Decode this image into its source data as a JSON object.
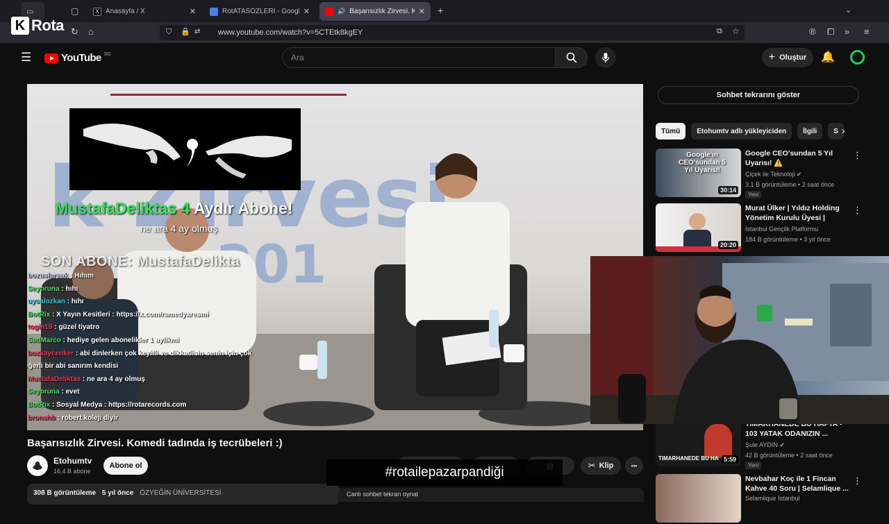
{
  "browser": {
    "tabs": [
      {
        "label": "Anasayfa / X",
        "active": false
      },
      {
        "label": "RotATASÖZLERİ - Google Dokü",
        "active": false
      },
      {
        "label": "Başarısızlık Zirvesi. Komedi",
        "active": true
      }
    ],
    "url": "www.youtube.com/watch?v=5CTEtk8kgEY",
    "new_tab": "+"
  },
  "overlay_logo": {
    "k": "K",
    "text": "Rota"
  },
  "youtube": {
    "logo": "YouTube",
    "region": "SG",
    "search_placeholder": "Ara",
    "create_label": "Oluştur"
  },
  "stream_overlay": {
    "sub_name": "MustafaDeliktas",
    "sub_months": "4",
    "sub_suffix": "Aydır Abone!",
    "sub_message": "ne ara 4 ay olmuş",
    "last_sub": "SON ABONE: MustafaDelikta",
    "banner_text": "k Zirvesi",
    "banner_year": "l 201",
    "hashtag": "#rotailepazarpandiği",
    "chat": [
      {
        "user": "bozuslarsuk",
        "msg": ": Hıhım",
        "color": "#b6b9e8"
      },
      {
        "user": "Seyoruna",
        "msg": ": hıhı",
        "color": "#3be05d"
      },
      {
        "user": "uysalozkan",
        "msg": ": hıhı",
        "color": "#35c8d8"
      },
      {
        "user": "BotRix",
        "msg": ": X Yayın Kesitleri : https://x.com/ramedyaresmi",
        "color": "#3be05d"
      },
      {
        "user": "togin19",
        "msg": ": güzel tiyatro",
        "color": "#e8355a"
      },
      {
        "user": "SadMarco",
        "msg": ": hediye gelen abonelikler 1 aylikmi",
        "color": "#3be05d"
      },
      {
        "user": "bozkaycenker",
        "msg": ": abi dinlerken çok keyifli ve dikkatlisin senin için çok",
        "color": "#e8355a"
      },
      {
        "user": "",
        "msg": "değerli bir abi sanırım kendisi",
        "color": "#ffffff"
      },
      {
        "user": "MustafaDeliktas",
        "msg": ": ne ara 4 ay olmuş",
        "color": "#e8355a"
      },
      {
        "user": "Seyoruna",
        "msg": ": evet",
        "color": "#3be05d"
      },
      {
        "user": "BotRix",
        "msg": ": Sosyal Medya : https://rotarecords.com",
        "color": "#3be05d"
      },
      {
        "user": "bronshb",
        "msg": ": robert koleji diyir",
        "color": "#e8355a"
      }
    ]
  },
  "video": {
    "title": "Başarısızlık Zirvesi. Komedi tadında iş tecrübeleri :)",
    "channel": "Etohumtv",
    "subscribers": "16,4 B abone",
    "subscribe_label": "Abone ol",
    "clip_label": "Klip",
    "more_label": "•••",
    "views": "308 B görüntüleme",
    "age": "5 yıl önce",
    "university": "ÖZYEĞİN ÜNİVERSİTESİ",
    "chat_replay_bottom": "Canlı sohbet tekrarı oynat"
  },
  "sidebar": {
    "chat_replay": "Sohbet tekrarını göster",
    "chips": [
      "Tümü",
      "Etohumtv adlı yükleyiciden",
      "İlgili",
      "S"
    ],
    "recommendations": [
      {
        "title": "Google CEO'sundan 5 Yıl Uyarısı! ⚠️",
        "channel": "Çiçek ile Teknoloji ✔",
        "meta": "3,1 B görüntüleme • 2 saat önce",
        "badge": "Yeni",
        "duration": "30:14",
        "thumb_text": "Google'ın CEO'sundan 5 Yıl Uyarısı!"
      },
      {
        "title": "Murat Ülker | Yıldız Holding Yönetim Kurulu Üyesi |",
        "channel": "İstanbul Gençlik Platformu",
        "meta": "184 B görüntüleme • 3 yıl önce",
        "badge": "",
        "duration": "20:20",
        "thumb_text": ""
      },
      {
        "title": "TIMARHANEDE BU HAFTA - 103 YATAK ODANIZIN ...",
        "channel": "Şule AYDIN ✔",
        "meta": "42 B görüntüleme • 2 saat önce",
        "badge": "Yeni",
        "duration": "5:59",
        "thumb_text": "TIMARHANEDE BU HA"
      },
      {
        "title": "Nevbahar Koç ile 1 Fincan Kahve 40 Soru | Selamlique ...",
        "channel": "Selamlique İstanbul",
        "meta": "",
        "badge": "",
        "duration": "",
        "thumb_text": ""
      }
    ]
  }
}
